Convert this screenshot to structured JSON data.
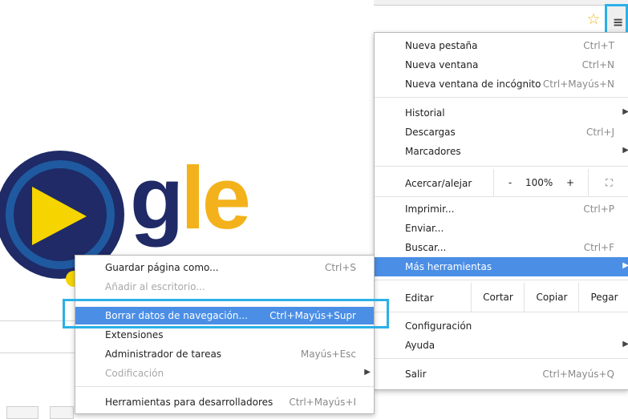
{
  "toolbar": {
    "star_icon": "star-icon",
    "menu_icon": "hamburger-menu-icon"
  },
  "logo": {
    "letters_dark": "g",
    "letters_light": "le",
    "colors": {
      "navy": "#1f2a66",
      "yellow": "#f3b21b",
      "accent": "#f5d400"
    }
  },
  "main_menu": {
    "group1": [
      {
        "label": "Nueva pestaña",
        "shortcut": "Ctrl+T"
      },
      {
        "label": "Nueva ventana",
        "shortcut": "Ctrl+N"
      },
      {
        "label": "Nueva ventana de incógnito",
        "shortcut": "Ctrl+Mayús+N"
      }
    ],
    "group2": [
      {
        "label": "Historial",
        "shortcut": ""
      },
      {
        "label": "Descargas",
        "shortcut": "Ctrl+J"
      },
      {
        "label": "Marcadores",
        "shortcut": ""
      }
    ],
    "zoom": {
      "label": "Acercar/alejar",
      "minus": "-",
      "value": "100%",
      "plus": "+",
      "fullscreen": "⛶"
    },
    "group3": [
      {
        "label": "Imprimir...",
        "shortcut": "Ctrl+P"
      },
      {
        "label": "Enviar...",
        "shortcut": ""
      },
      {
        "label": "Buscar...",
        "shortcut": "Ctrl+F"
      },
      {
        "label": "Más herramientas",
        "shortcut": ""
      }
    ],
    "edit": {
      "label": "Editar",
      "cut": "Cortar",
      "copy": "Copiar",
      "paste": "Pegar"
    },
    "group4": [
      {
        "label": "Configuración",
        "shortcut": ""
      },
      {
        "label": "Ayuda",
        "shortcut": ""
      }
    ],
    "exit": {
      "label": "Salir",
      "shortcut": "Ctrl+Mayús+Q"
    }
  },
  "sub_menu": {
    "items": [
      {
        "label": "Guardar página como...",
        "shortcut": "Ctrl+S"
      },
      {
        "label": "Añadir al escritorio...",
        "shortcut": ""
      },
      {
        "label": "Borrar datos de navegación...",
        "shortcut": "Ctrl+Mayús+Supr"
      },
      {
        "label": "Extensiones",
        "shortcut": ""
      },
      {
        "label": "Administrador de tareas",
        "shortcut": "Mayús+Esc"
      },
      {
        "label": "Codificación",
        "shortcut": ""
      },
      {
        "label": "Herramientas para desarrolladores",
        "shortcut": "Ctrl+Mayús+I"
      }
    ]
  },
  "highlight_color": "#2bb0e8",
  "active_color": "#4a8ee6"
}
